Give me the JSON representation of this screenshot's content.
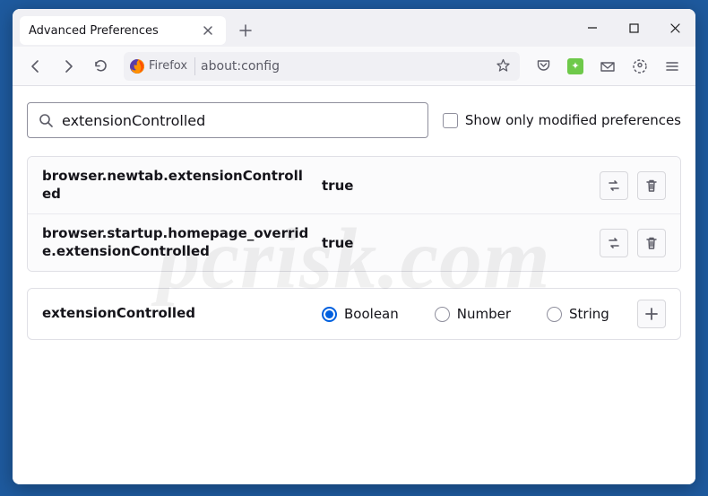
{
  "window": {
    "tab_title": "Advanced Preferences",
    "identity_label": "Firefox",
    "url": "about:config",
    "search_value": "extensionControlled",
    "show_modified_label": "Show only modified preferences"
  },
  "prefs": [
    {
      "name": "browser.newtab.extensionControlled",
      "value": "true",
      "modified": true,
      "has_toggle": true,
      "has_reset": true
    },
    {
      "name": "browser.startup.homepage_override.extensionControlled",
      "value": "true",
      "modified": true,
      "has_toggle": true,
      "has_reset": true
    }
  ],
  "new_pref": {
    "name": "extensionControlled",
    "types": [
      "Boolean",
      "Number",
      "String"
    ],
    "selected_index": 0
  },
  "watermark": {
    "line1": "pcrisk.com",
    "badge": ""
  }
}
